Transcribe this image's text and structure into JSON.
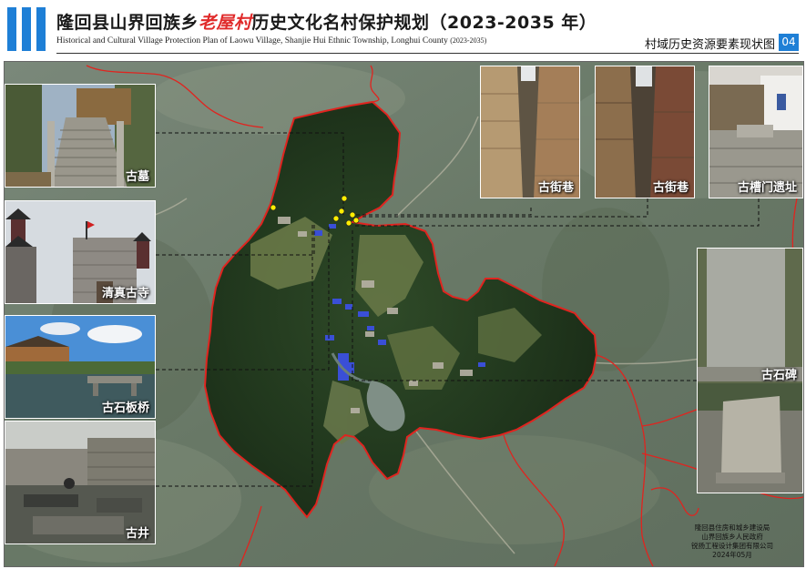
{
  "header": {
    "title_pre": "隆回县山界回族乡",
    "title_highlight": "老屋村",
    "title_post": "历史文化名村保护规划（2023-2035 年）",
    "subtitle_main": "Historical and Cultural Village Protection Plan of Laowu Village, Shanjie Hui Ethnic Township, Longhui County",
    "subtitle_years": "(2023-2035)",
    "sheet_title": "村域历史资源要素现状图",
    "sheet_number": "04",
    "accent_color": "#1e7fd6",
    "highlight_color": "#e02a2a"
  },
  "photos": [
    {
      "id": "ancient-tomb",
      "caption": "古墓"
    },
    {
      "id": "mosque",
      "caption": "清真古寺"
    },
    {
      "id": "stone-slab-bridge",
      "caption": "古石板桥"
    },
    {
      "id": "ancient-well",
      "caption": "古井"
    },
    {
      "id": "ancient-street-1",
      "caption": "古街巷"
    },
    {
      "id": "ancient-street-2",
      "caption": "古街巷"
    },
    {
      "id": "ancient-gate-site",
      "caption": "古槽门遗址"
    },
    {
      "id": "stone-stele",
      "caption": "古石碑"
    }
  ],
  "credits": {
    "line1": "隆回县住房和城乡建设局",
    "line2": "山界回族乡人民政府",
    "line3": "锐扬工程设计集团有限公司",
    "date": "2024年05月"
  },
  "map": {
    "boundary_color": "#e0241f",
    "leader_color": "#111111",
    "marker_color": "#ffee00"
  }
}
